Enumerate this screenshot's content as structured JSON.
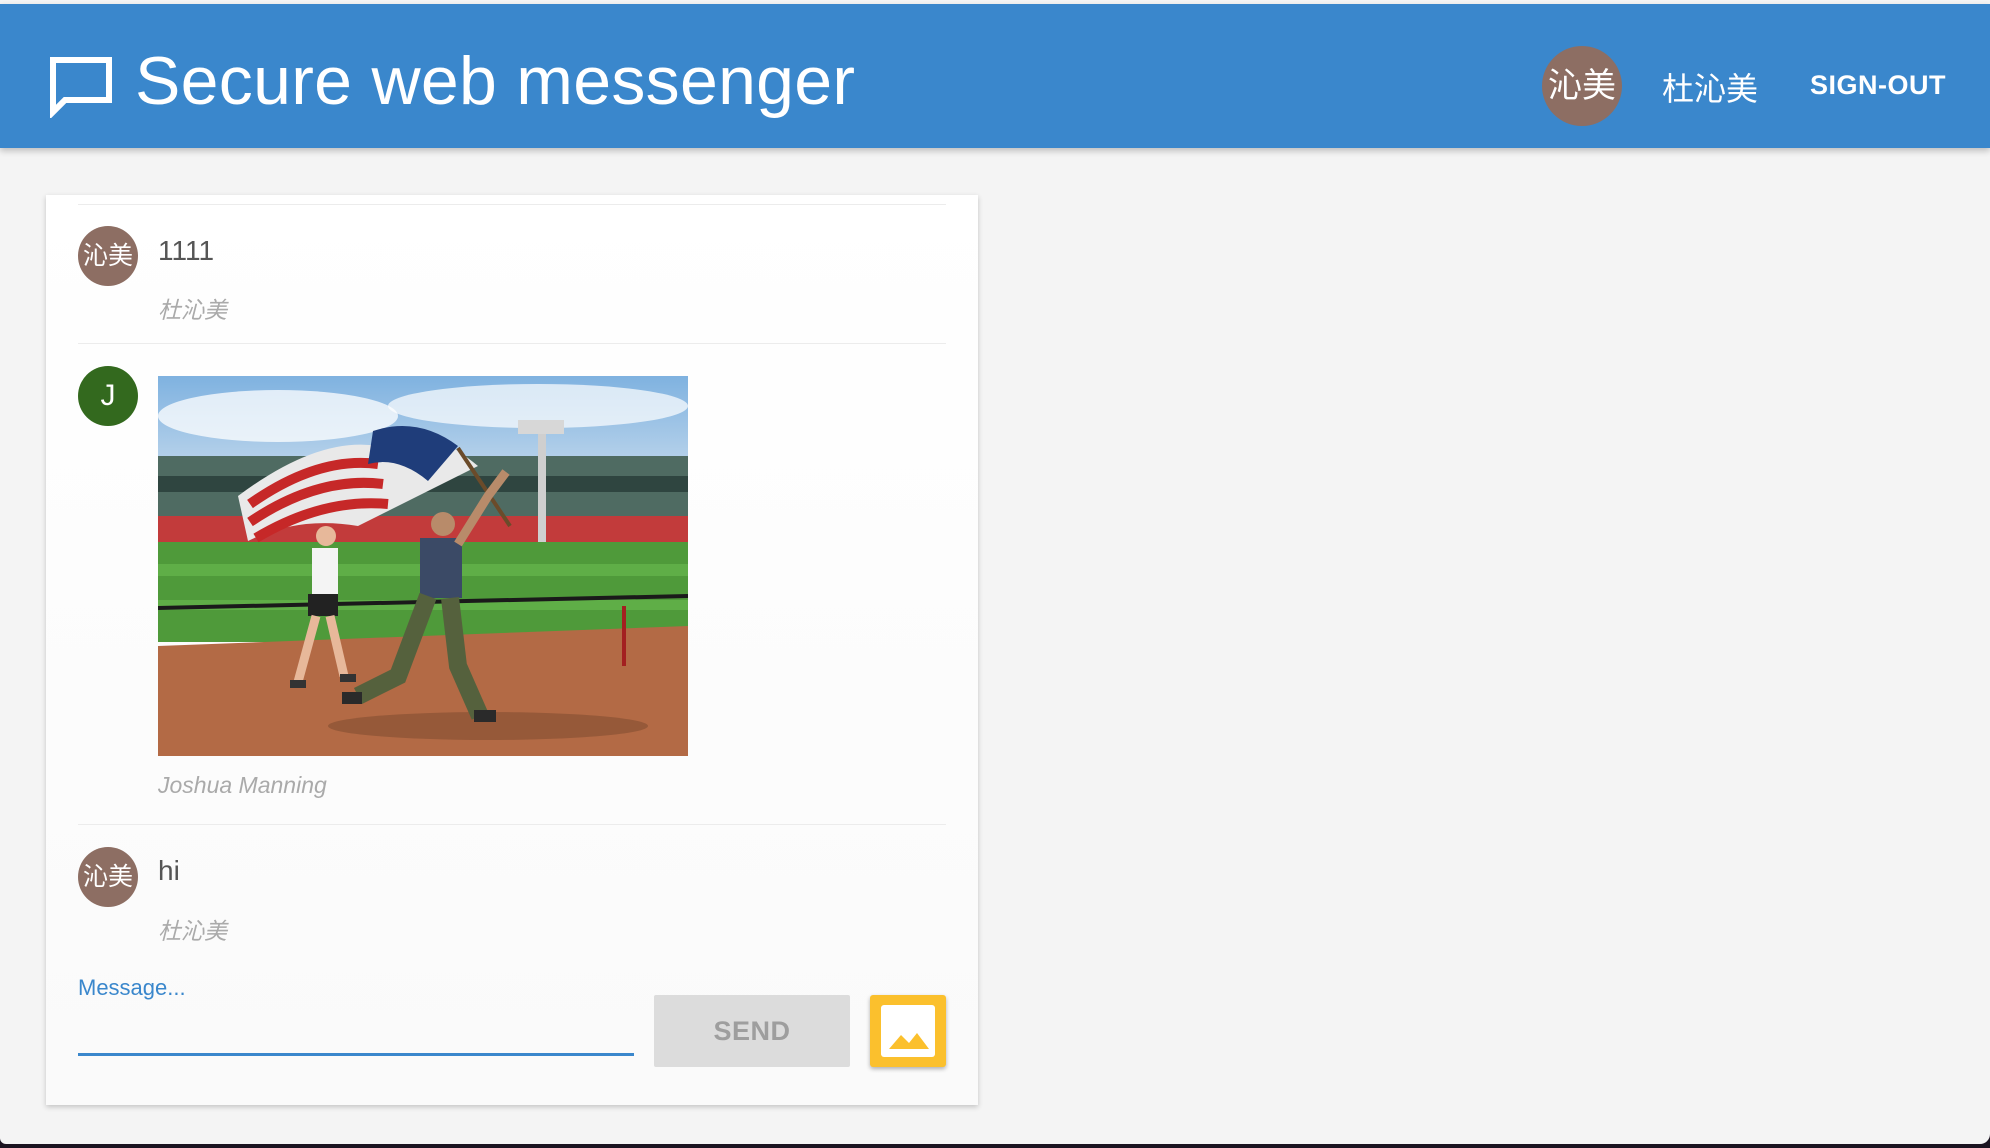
{
  "header": {
    "title": "Secure web messenger",
    "user": {
      "avatar_text": "沁美",
      "name": "杜沁美"
    },
    "signout_label": "SIGN-OUT"
  },
  "messages": [
    {
      "avatar_text": "沁美",
      "text": "1111",
      "author": "杜沁美"
    },
    {
      "avatar_text": "J",
      "type": "image",
      "image_description": "person-running-with-flag-photo",
      "author": "Joshua Manning"
    },
    {
      "avatar_text": "沁美",
      "text": "hi",
      "author": "杜沁美"
    }
  ],
  "composer": {
    "label": "Message...",
    "value": "",
    "send_label": "SEND",
    "upload_icon": "image-icon"
  },
  "colors": {
    "primary": "#3a87cc",
    "avatar_brown": "#8d6e63",
    "avatar_green": "#33691e",
    "upload_yellow": "#fbc02d"
  }
}
